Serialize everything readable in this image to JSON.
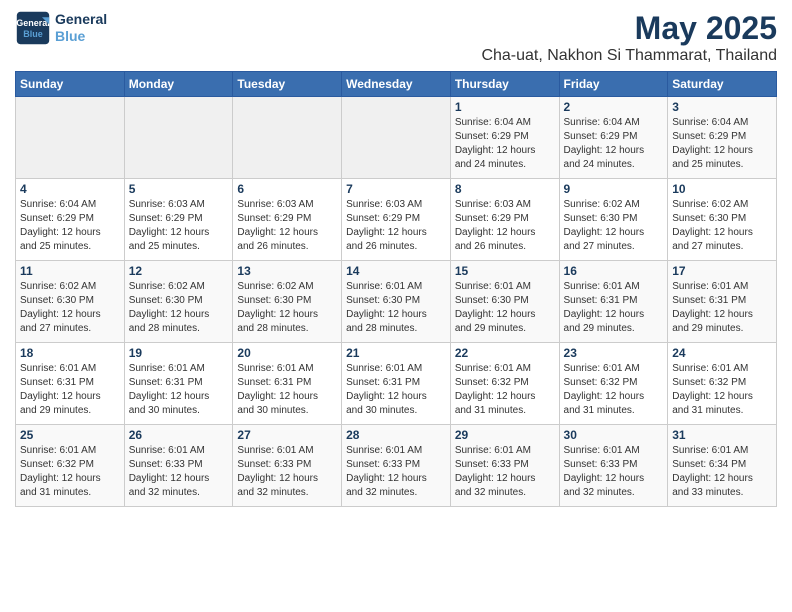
{
  "logo": {
    "line1": "General",
    "line2": "Blue"
  },
  "title": "May 2025",
  "subtitle": "Cha-uat, Nakhon Si Thammarat, Thailand",
  "days_of_week": [
    "Sunday",
    "Monday",
    "Tuesday",
    "Wednesday",
    "Thursday",
    "Friday",
    "Saturday"
  ],
  "weeks": [
    [
      {
        "day": "",
        "info": ""
      },
      {
        "day": "",
        "info": ""
      },
      {
        "day": "",
        "info": ""
      },
      {
        "day": "",
        "info": ""
      },
      {
        "day": "1",
        "info": "Sunrise: 6:04 AM\nSunset: 6:29 PM\nDaylight: 12 hours\nand 24 minutes."
      },
      {
        "day": "2",
        "info": "Sunrise: 6:04 AM\nSunset: 6:29 PM\nDaylight: 12 hours\nand 24 minutes."
      },
      {
        "day": "3",
        "info": "Sunrise: 6:04 AM\nSunset: 6:29 PM\nDaylight: 12 hours\nand 25 minutes."
      }
    ],
    [
      {
        "day": "4",
        "info": "Sunrise: 6:04 AM\nSunset: 6:29 PM\nDaylight: 12 hours\nand 25 minutes."
      },
      {
        "day": "5",
        "info": "Sunrise: 6:03 AM\nSunset: 6:29 PM\nDaylight: 12 hours\nand 25 minutes."
      },
      {
        "day": "6",
        "info": "Sunrise: 6:03 AM\nSunset: 6:29 PM\nDaylight: 12 hours\nand 26 minutes."
      },
      {
        "day": "7",
        "info": "Sunrise: 6:03 AM\nSunset: 6:29 PM\nDaylight: 12 hours\nand 26 minutes."
      },
      {
        "day": "8",
        "info": "Sunrise: 6:03 AM\nSunset: 6:29 PM\nDaylight: 12 hours\nand 26 minutes."
      },
      {
        "day": "9",
        "info": "Sunrise: 6:02 AM\nSunset: 6:30 PM\nDaylight: 12 hours\nand 27 minutes."
      },
      {
        "day": "10",
        "info": "Sunrise: 6:02 AM\nSunset: 6:30 PM\nDaylight: 12 hours\nand 27 minutes."
      }
    ],
    [
      {
        "day": "11",
        "info": "Sunrise: 6:02 AM\nSunset: 6:30 PM\nDaylight: 12 hours\nand 27 minutes."
      },
      {
        "day": "12",
        "info": "Sunrise: 6:02 AM\nSunset: 6:30 PM\nDaylight: 12 hours\nand 28 minutes."
      },
      {
        "day": "13",
        "info": "Sunrise: 6:02 AM\nSunset: 6:30 PM\nDaylight: 12 hours\nand 28 minutes."
      },
      {
        "day": "14",
        "info": "Sunrise: 6:01 AM\nSunset: 6:30 PM\nDaylight: 12 hours\nand 28 minutes."
      },
      {
        "day": "15",
        "info": "Sunrise: 6:01 AM\nSunset: 6:30 PM\nDaylight: 12 hours\nand 29 minutes."
      },
      {
        "day": "16",
        "info": "Sunrise: 6:01 AM\nSunset: 6:31 PM\nDaylight: 12 hours\nand 29 minutes."
      },
      {
        "day": "17",
        "info": "Sunrise: 6:01 AM\nSunset: 6:31 PM\nDaylight: 12 hours\nand 29 minutes."
      }
    ],
    [
      {
        "day": "18",
        "info": "Sunrise: 6:01 AM\nSunset: 6:31 PM\nDaylight: 12 hours\nand 29 minutes."
      },
      {
        "day": "19",
        "info": "Sunrise: 6:01 AM\nSunset: 6:31 PM\nDaylight: 12 hours\nand 30 minutes."
      },
      {
        "day": "20",
        "info": "Sunrise: 6:01 AM\nSunset: 6:31 PM\nDaylight: 12 hours\nand 30 minutes."
      },
      {
        "day": "21",
        "info": "Sunrise: 6:01 AM\nSunset: 6:31 PM\nDaylight: 12 hours\nand 30 minutes."
      },
      {
        "day": "22",
        "info": "Sunrise: 6:01 AM\nSunset: 6:32 PM\nDaylight: 12 hours\nand 31 minutes."
      },
      {
        "day": "23",
        "info": "Sunrise: 6:01 AM\nSunset: 6:32 PM\nDaylight: 12 hours\nand 31 minutes."
      },
      {
        "day": "24",
        "info": "Sunrise: 6:01 AM\nSunset: 6:32 PM\nDaylight: 12 hours\nand 31 minutes."
      }
    ],
    [
      {
        "day": "25",
        "info": "Sunrise: 6:01 AM\nSunset: 6:32 PM\nDaylight: 12 hours\nand 31 minutes."
      },
      {
        "day": "26",
        "info": "Sunrise: 6:01 AM\nSunset: 6:33 PM\nDaylight: 12 hours\nand 32 minutes."
      },
      {
        "day": "27",
        "info": "Sunrise: 6:01 AM\nSunset: 6:33 PM\nDaylight: 12 hours\nand 32 minutes."
      },
      {
        "day": "28",
        "info": "Sunrise: 6:01 AM\nSunset: 6:33 PM\nDaylight: 12 hours\nand 32 minutes."
      },
      {
        "day": "29",
        "info": "Sunrise: 6:01 AM\nSunset: 6:33 PM\nDaylight: 12 hours\nand 32 minutes."
      },
      {
        "day": "30",
        "info": "Sunrise: 6:01 AM\nSunset: 6:33 PM\nDaylight: 12 hours\nand 32 minutes."
      },
      {
        "day": "31",
        "info": "Sunrise: 6:01 AM\nSunset: 6:34 PM\nDaylight: 12 hours\nand 33 minutes."
      }
    ]
  ]
}
